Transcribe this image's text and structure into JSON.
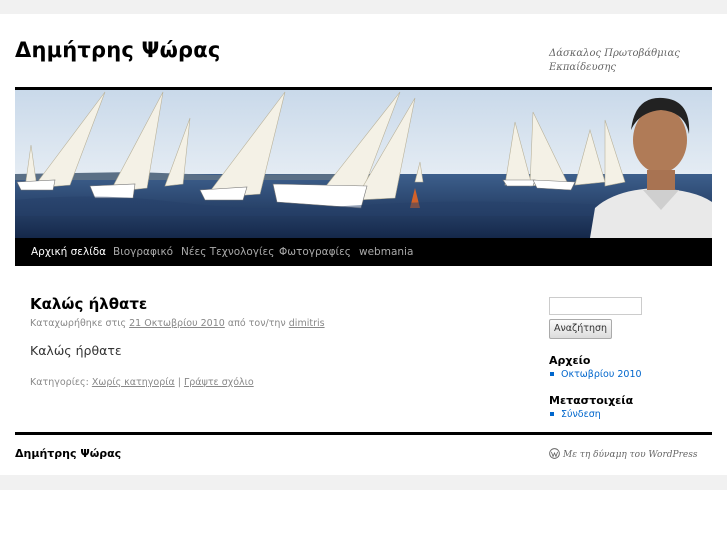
{
  "site": {
    "title": "Δημήτρης Ψώρας",
    "description": "Δάσκαλος Πρωτοβάθμιας Εκπαίδευσης"
  },
  "nav": {
    "items": [
      {
        "label": "Αρχική σελίδα",
        "current": true
      },
      {
        "label": "Βιογραφικό"
      },
      {
        "label": "Νέες Τεχνολογίες"
      },
      {
        "label": "Φωτογραφίες"
      },
      {
        "label": "webmania"
      }
    ]
  },
  "post": {
    "title": "Καλώς ήλθατε",
    "meta_prefix": "Καταχωρήθηκε στις",
    "date": "21 Οκτωβρίου 2010",
    "meta_by": "από τον/την",
    "author": "dimitris",
    "body": "Καλώς ήρθατε",
    "categories_label": "Κατηγορίες:",
    "category": "Χωρίς κατηγορία",
    "separator": "|",
    "comment_link": "Γράψτε σχόλιο"
  },
  "sidebar": {
    "search": {
      "value": "",
      "button_label": "Αναζήτηση"
    },
    "archive": {
      "title": "Αρχείο",
      "items": [
        "Οκτωβρίου 2010"
      ]
    },
    "meta": {
      "title": "Μεταστοιχεία",
      "items": [
        "Σύνδεση"
      ]
    }
  },
  "footer": {
    "site_title": "Δημήτρης Ψώρας",
    "credit": "Με τη δύναμη του WordPress"
  },
  "icons": {
    "footer_credit": "wordpress-icon"
  },
  "colors": {
    "link": "#0066cc",
    "nav_bg": "#000000",
    "band": "#f1f1f1"
  }
}
